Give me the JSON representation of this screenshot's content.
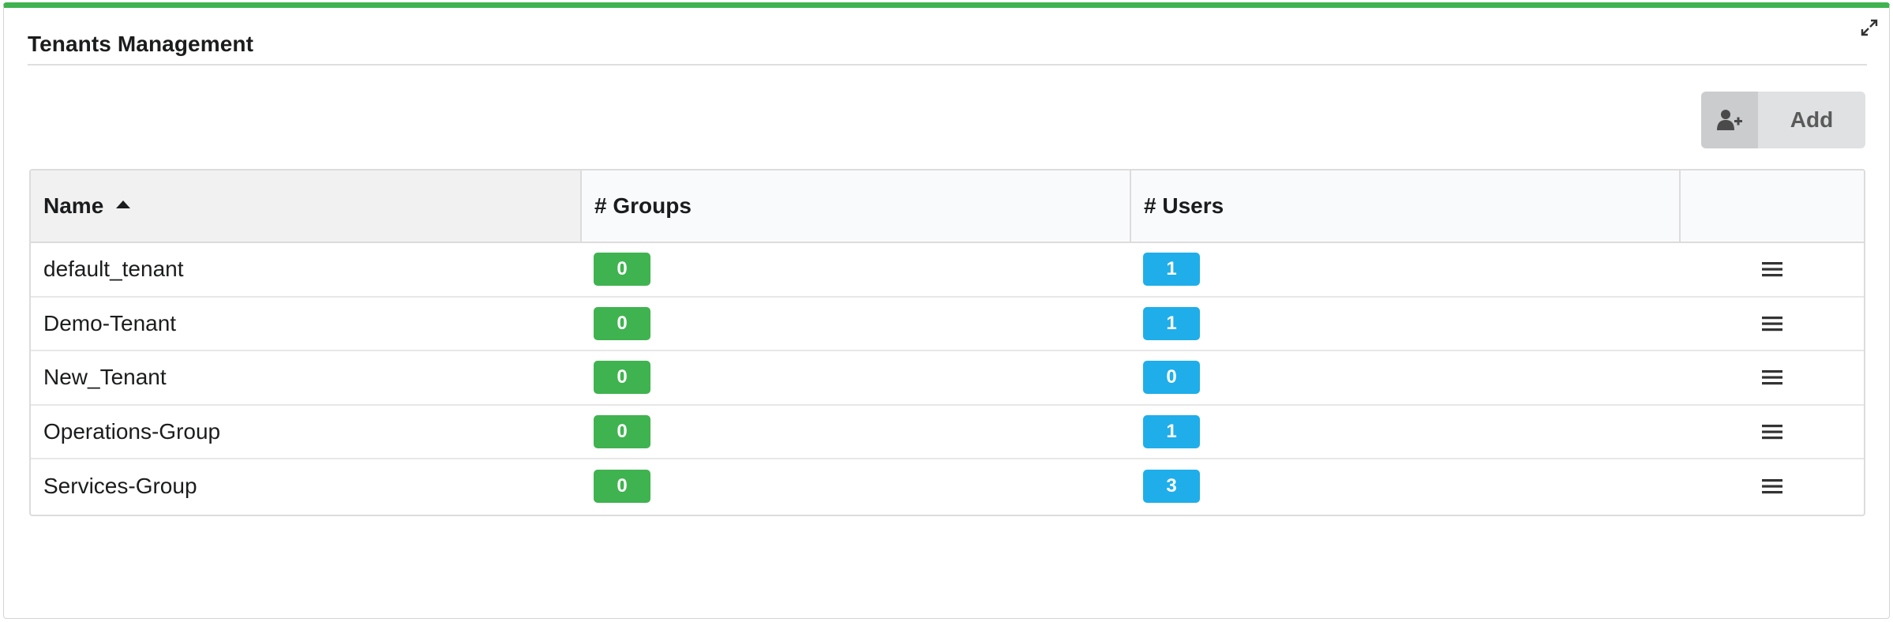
{
  "widget": {
    "title": "Tenants Management",
    "accent_color": "#3fb34f",
    "add_button_label": "Add",
    "add_button_icon": "user-plus-icon",
    "expand_icon": "expand-icon"
  },
  "table": {
    "columns": [
      {
        "label": "Name",
        "sorted": "ascending"
      },
      {
        "label": "# Groups"
      },
      {
        "label": "# Users"
      },
      {
        "label": ""
      }
    ],
    "rows": [
      {
        "name": "default_tenant",
        "groups": "0",
        "users": "1"
      },
      {
        "name": "Demo-Tenant",
        "groups": "0",
        "users": "1"
      },
      {
        "name": "New_Tenant",
        "groups": "0",
        "users": "0"
      },
      {
        "name": "Operations-Group",
        "groups": "0",
        "users": "1"
      },
      {
        "name": "Services-Group",
        "groups": "0",
        "users": "3"
      }
    ],
    "groups_badge_color": "#3fb34f",
    "users_badge_color": "#1faee9",
    "row_action_icon": "menu-icon"
  }
}
